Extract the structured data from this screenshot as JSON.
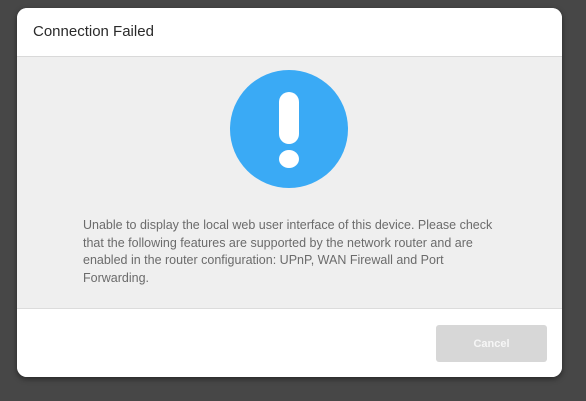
{
  "dialog": {
    "title": "Connection Failed",
    "icon": "exclamation-circle-icon",
    "icon_color": "#3aaaf5",
    "message": "Unable to display the local web user interface of this device. Please check that the following features are supported by the network router and are enabled in the router configuration: UPnP, WAN Firewall and Port Forwarding.",
    "buttons": {
      "cancel_label": "Cancel"
    }
  }
}
